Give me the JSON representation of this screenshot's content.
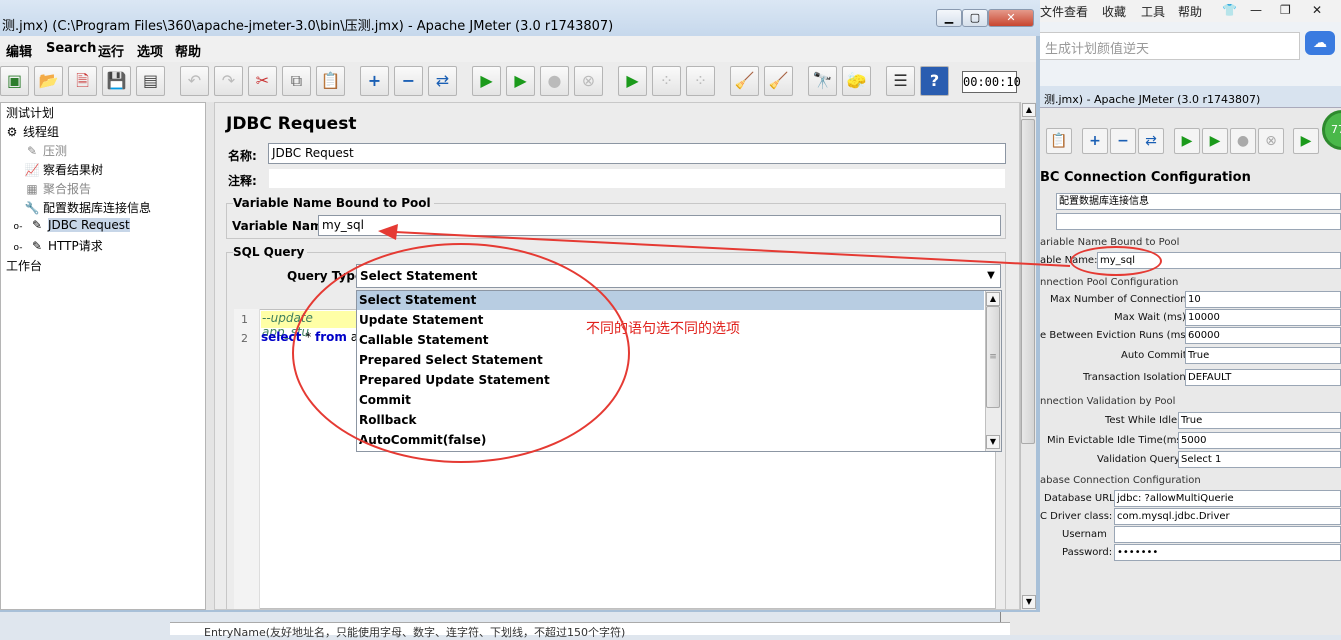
{
  "main_window": {
    "title": "测.jmx) (C:\\Program Files\\360\\apache-jmeter-3.0\\bin\\压测.jmx) - Apache JMeter (3.0 r1743807)",
    "menus": [
      "编辑",
      "Search",
      "运行",
      "选项",
      "帮助"
    ],
    "timer": "00:00:10"
  },
  "tree": {
    "items": [
      {
        "label": "测试计划",
        "icon": "test-plan-icon"
      },
      {
        "label": "线程组",
        "icon": "gear-icon"
      },
      {
        "label": "压测",
        "icon": "sampler-icon"
      },
      {
        "label": "察看结果树",
        "icon": "listener-icon"
      },
      {
        "label": "聚合报告",
        "icon": "report-icon"
      },
      {
        "label": "配置数据库连接信息",
        "icon": "config-icon"
      },
      {
        "label": "JDBC Request",
        "icon": "sampler-icon"
      },
      {
        "label": "HTTP请求",
        "icon": "sampler-icon"
      },
      {
        "label": "工作台",
        "icon": "workbench-icon"
      }
    ]
  },
  "panel": {
    "title": "JDBC Request",
    "name_label": "名称:",
    "name_value": "JDBC Request",
    "comment_label": "注释:",
    "pool_group": "Variable Name Bound to Pool",
    "variable_label": "Variable Name:",
    "variable_value": "my_sql",
    "sql_group": "SQL Query",
    "query_type_label": "Query Type:",
    "query_type_value": "Select Statement",
    "code_lines": [
      "--update app_stu",
      "select * from ap"
    ],
    "code_select": "select",
    "code_star": " * ",
    "code_from": "from",
    "code_rest": " ap",
    "line_numbers": [
      "1",
      "2"
    ]
  },
  "dropdown_options": [
    "Select Statement",
    "Update Statement",
    "Callable Statement",
    "Prepared Select Statement",
    "Prepared Update Statement",
    "Commit",
    "Rollback",
    "AutoCommit(false)"
  ],
  "annotation": "不同的语句选不同的选项",
  "background_window": {
    "menus": [
      "文件",
      "查看",
      "收藏",
      "工具",
      "帮助"
    ],
    "search_placeholder": "生成计划颜值逆天",
    "title": "测.jmx) - Apache JMeter (3.0 r1743807)",
    "badge": "77",
    "panel_title": "BC Connection Configuration",
    "name_value": "配置数据库连接信息",
    "pool_section": "ariable Name Bound to Pool",
    "var_label": "able Name:",
    "var_value": "my_sql",
    "pool_config_section": "nnection Pool Configuration",
    "max_conn_label": "Max Number of Connections:",
    "max_conn": "10",
    "max_wait_label": "Max Wait (ms):",
    "max_wait": "10000",
    "eviction_label": "e Between Eviction Runs (ms):",
    "eviction": "60000",
    "autocommit_label": "Auto Commit:",
    "autocommit": "True",
    "isolation_label": "Transaction Isolation:",
    "isolation": "DEFAULT",
    "validation_section": "nnection Validation by Pool",
    "test_idle_label": "Test While Idle:",
    "test_idle": "True",
    "min_evict_label": "Min Evictable Idle Time(ms):",
    "min_evict": "5000",
    "validation_query_label": "Validation Query:",
    "validation_query": "Select 1",
    "db_section": "abase Connection Configuration",
    "db_url_label": "Database URL:",
    "db_url": "jdbc:          ?allowMultiQuerie",
    "driver_label": "C Driver class:",
    "driver": "com.mysql.jdbc.Driver",
    "username_label": "Usernam",
    "password_label": "Password:",
    "password": "•••••••",
    "bottom_text": "EntryName(友好地址名，只能使用字母、数字、连字符、下划线，不超过150个字符)"
  }
}
